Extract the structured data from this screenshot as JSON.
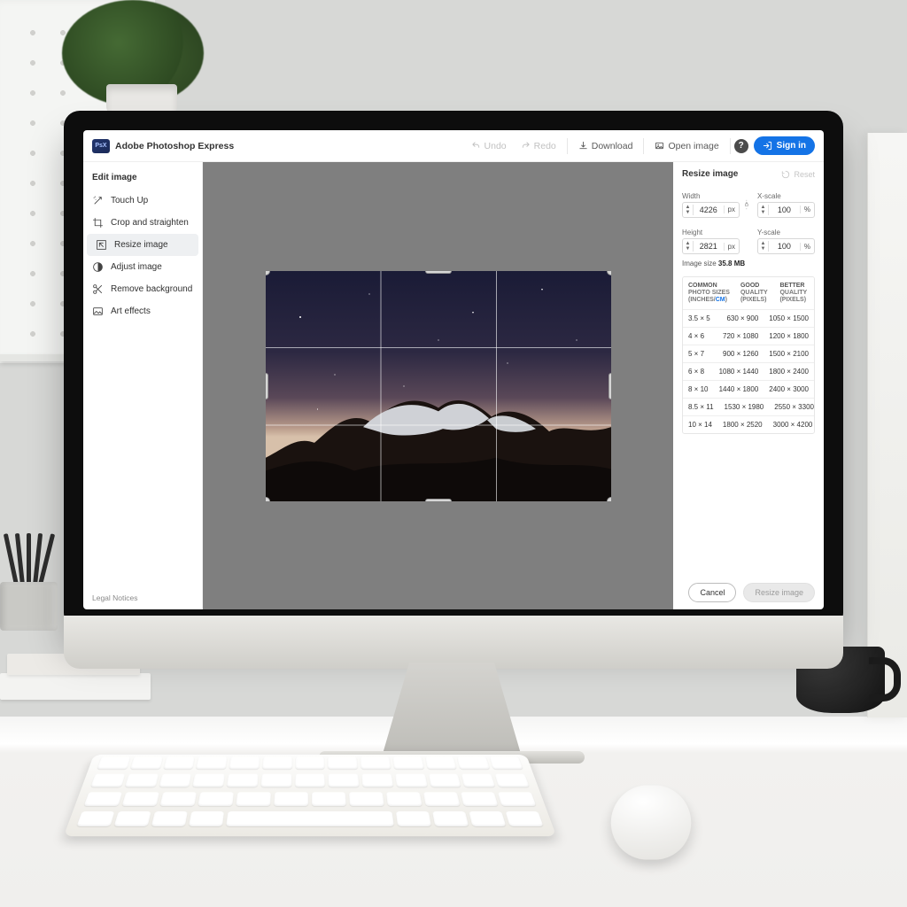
{
  "header": {
    "app_name": "Adobe Photoshop Express",
    "undo": "Undo",
    "redo": "Redo",
    "download": "Download",
    "open_image": "Open image",
    "sign_in": "Sign in"
  },
  "sidebar": {
    "title": "Edit image",
    "items": [
      {
        "label": "Touch Up"
      },
      {
        "label": "Crop and straighten"
      },
      {
        "label": "Resize image"
      },
      {
        "label": "Adjust image"
      },
      {
        "label": "Remove background"
      },
      {
        "label": "Art effects"
      }
    ],
    "active_index": 2,
    "legal": "Legal Notices"
  },
  "resize": {
    "panel_title": "Resize image",
    "reset": "Reset",
    "width_label": "Width",
    "height_label": "Height",
    "xscale_label": "X-scale",
    "yscale_label": "Y-scale",
    "width_value": "4226",
    "height_value": "2821",
    "px_unit": "px",
    "xscale_value": "100",
    "yscale_value": "100",
    "pct_unit": "%",
    "image_size_label": "Image size",
    "image_size_value": "35.8 MB",
    "table": {
      "col1_l1": "COMMON",
      "col1_l2a": "PHOTO SIZES",
      "col1_l2b_inches": "(INCHES",
      "col1_l2b_sep": "/",
      "col1_l2b_cm": "CM",
      "col1_l2b_close": ")",
      "col2_l1": "GOOD",
      "col2_l2": "QUALITY",
      "col2_l3": "(PIXELS)",
      "col3_l1": "BETTER",
      "col3_l2": "QUALITY",
      "col3_l3": "(PIXELS)",
      "rows": [
        {
          "size": "3.5 × 5",
          "good": "630 × 900",
          "better": "1050 × 1500"
        },
        {
          "size": "4 × 6",
          "good": "720 × 1080",
          "better": "1200 × 1800"
        },
        {
          "size": "5 × 7",
          "good": "900 × 1260",
          "better": "1500 × 2100"
        },
        {
          "size": "6 × 8",
          "good": "1080 × 1440",
          "better": "1800 × 2400"
        },
        {
          "size": "8 × 10",
          "good": "1440 × 1800",
          "better": "2400 × 3000"
        },
        {
          "size": "8.5 × 11",
          "good": "1530 × 1980",
          "better": "2550 × 3300"
        },
        {
          "size": "10 × 14",
          "good": "1800 × 2520",
          "better": "3000 × 4200"
        }
      ]
    },
    "cancel": "Cancel",
    "apply": "Resize image"
  }
}
